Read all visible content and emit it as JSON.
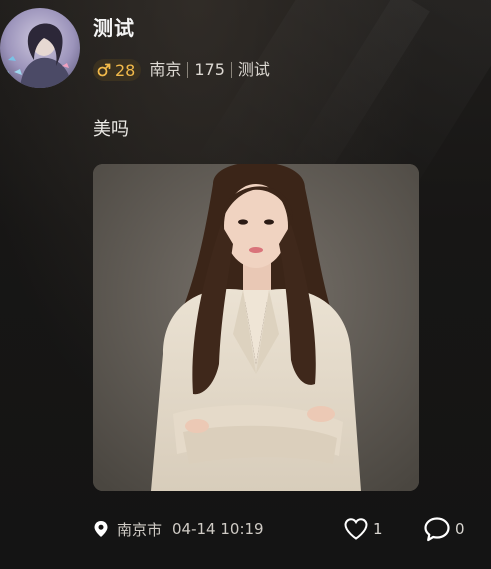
{
  "colors": {
    "background": "#161514",
    "badge_bg": "#3a3120",
    "badge_text": "#f1b94a",
    "text_primary": "#f4f4f4",
    "text_secondary": "#cfcbc5"
  },
  "post": {
    "username": "测试",
    "gender_icon": "male-icon",
    "age": "28",
    "city": "南京",
    "height": "175",
    "occupation": "测试",
    "content": "美吗",
    "location_icon": "location-pin-icon",
    "location": "南京市",
    "time": "04-14 10:19",
    "like_icon": "heart-outline-icon",
    "like_count": "1",
    "comment_icon": "comment-bubble-icon",
    "comment_count": "0"
  }
}
